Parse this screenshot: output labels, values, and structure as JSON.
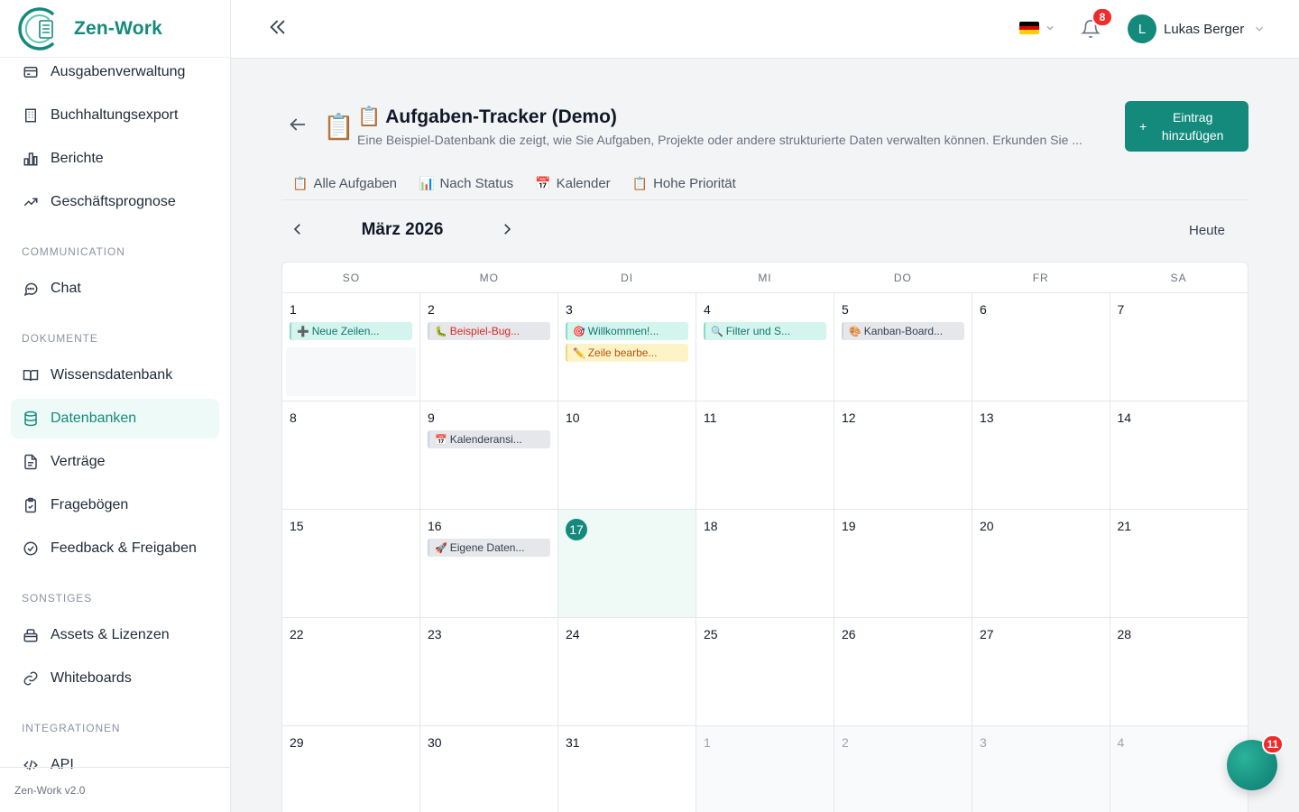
{
  "app": {
    "name": "Zen-Work",
    "version": "Zen-Work v2.0"
  },
  "sidebar": {
    "items_top": [
      {
        "label": "Ausgabenverwaltung",
        "icon": "wallet-icon"
      },
      {
        "label": "Buchhaltungsexport",
        "icon": "building-icon"
      },
      {
        "label": "Berichte",
        "icon": "bar-chart-icon"
      },
      {
        "label": "Geschäftsprognose",
        "icon": "trend-icon"
      }
    ],
    "sections": {
      "communication": "COMMUNICATION",
      "dokumente": "DOKUMENTE",
      "sonstiges": "SONSTIGES",
      "integrationen": "INTEGRATIONEN"
    },
    "chat": "Chat",
    "docs": [
      "Wissensdatenbank",
      "Datenbanken",
      "Verträge",
      "Fragebögen",
      "Feedback & Freigaben"
    ],
    "other": [
      "Assets & Lizenzen",
      "Whiteboards"
    ],
    "api": "API"
  },
  "topbar": {
    "language": "DE",
    "notifications": "8",
    "user_initial": "L",
    "user_name": "Lukas Berger"
  },
  "database": {
    "icon": "📋",
    "title": "📋 Aufgaben-Tracker (Demo)",
    "description": "Eine Beispiel-Datenbank die zeigt, wie Sie Aufgaben, Projekte oder andere strukturierte Daten verwalten können. Erkunden Sie ...",
    "add_line1": "Eintrag",
    "add_line2": "hinzufügen",
    "add_plus": "+"
  },
  "tabs": [
    {
      "icon": "📋",
      "label": "Alle Aufgaben"
    },
    {
      "icon": "📊",
      "label": "Nach Status"
    },
    {
      "icon": "📅",
      "label": "Kalender"
    },
    {
      "icon": "📋",
      "label": "Hohe Priorität"
    }
  ],
  "calendar": {
    "month": "März 2026",
    "today_label": "Heute",
    "weekdays": [
      "SO",
      "MO",
      "DI",
      "MI",
      "DO",
      "FR",
      "SA"
    ],
    "days": [
      {
        "n": "1",
        "events": [
          {
            "icon": "➕",
            "text": "Neue Zeilen...",
            "style": "teal"
          }
        ]
      },
      {
        "n": "2",
        "events": [
          {
            "icon": "🐛",
            "text": "Beispiel-Bug...",
            "style": "red"
          }
        ]
      },
      {
        "n": "3",
        "events": [
          {
            "icon": "🎯",
            "text": "Willkommen!...",
            "style": "teal"
          },
          {
            "icon": "✏️",
            "text": "Zeile bearbe...",
            "style": "yellow"
          }
        ]
      },
      {
        "n": "4",
        "events": [
          {
            "icon": "🔍",
            "text": "Filter und S...",
            "style": "teal"
          }
        ]
      },
      {
        "n": "5",
        "events": [
          {
            "icon": "🎨",
            "text": "Kanban-Board...",
            "style": "gray"
          }
        ]
      },
      {
        "n": "6",
        "events": []
      },
      {
        "n": "7",
        "events": []
      },
      {
        "n": "8",
        "events": []
      },
      {
        "n": "9",
        "events": [
          {
            "icon": "📅",
            "text": "Kalenderansi...",
            "style": "gray"
          }
        ]
      },
      {
        "n": "10",
        "events": []
      },
      {
        "n": "11",
        "events": []
      },
      {
        "n": "12",
        "events": []
      },
      {
        "n": "13",
        "events": []
      },
      {
        "n": "14",
        "events": []
      },
      {
        "n": "15",
        "events": []
      },
      {
        "n": "16",
        "events": [
          {
            "icon": "🚀",
            "text": "Eigene Daten...",
            "style": "gray"
          }
        ]
      },
      {
        "n": "17",
        "events": [],
        "today": true
      },
      {
        "n": "18",
        "events": []
      },
      {
        "n": "19",
        "events": []
      },
      {
        "n": "20",
        "events": []
      },
      {
        "n": "21",
        "events": []
      },
      {
        "n": "22",
        "events": []
      },
      {
        "n": "23",
        "events": []
      },
      {
        "n": "24",
        "events": []
      },
      {
        "n": "25",
        "events": []
      },
      {
        "n": "26",
        "events": []
      },
      {
        "n": "27",
        "events": []
      },
      {
        "n": "28",
        "events": []
      },
      {
        "n": "29",
        "events": []
      },
      {
        "n": "30",
        "events": []
      },
      {
        "n": "31",
        "events": []
      },
      {
        "n": "1",
        "events": [],
        "other": true
      },
      {
        "n": "2",
        "events": [],
        "other": true
      },
      {
        "n": "3",
        "events": [],
        "other": true
      },
      {
        "n": "4",
        "events": [],
        "other": true
      }
    ]
  },
  "chat_badge": "11",
  "colors": {
    "accent": "#148a7c",
    "badge": "#ef2b2b"
  }
}
